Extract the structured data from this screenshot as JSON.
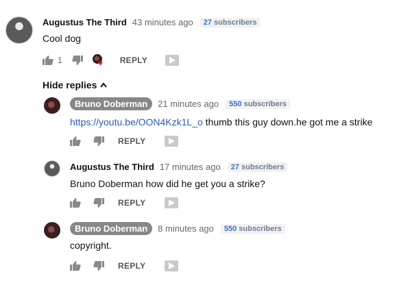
{
  "icons": {
    "like": "thumbs-up-icon",
    "dislike": "thumbs-down-icon",
    "flag": "flag-icon",
    "heart": "heart-icon",
    "chevron": "chevron-up-icon"
  },
  "colors": {
    "link": "#2a5db0",
    "heart": "#e11111",
    "chip": "#888888"
  },
  "main_comment": {
    "author": "Augustus The Third",
    "time": "43 minutes ago",
    "subscribers_count": "27",
    "subscribers_label": "subscribers",
    "text": "Cool dog",
    "likes": "1",
    "reply_label": "REPLY"
  },
  "hide_replies_label": "Hide replies",
  "replies": [
    {
      "author": "Bruno Doberman",
      "time": "21 minutes ago",
      "subscribers_count": "550",
      "subscribers_label": "subscribers",
      "link": "https://youtu.be/OON4Kzk1L_o",
      "text": " thumb this guy down.he got me a strike",
      "reply_label": "REPLY"
    },
    {
      "author": "Augustus The Third",
      "time": "17 minutes ago",
      "subscribers_count": "27",
      "subscribers_label": "subscribers",
      "text": "Bruno  Doberman how did he get you a strike?",
      "reply_label": "REPLY"
    },
    {
      "author": "Bruno Doberman",
      "time": "8 minutes ago",
      "subscribers_count": "550",
      "subscribers_label": "subscribers",
      "text": "copyright.",
      "reply_label": "REPLY"
    }
  ]
}
